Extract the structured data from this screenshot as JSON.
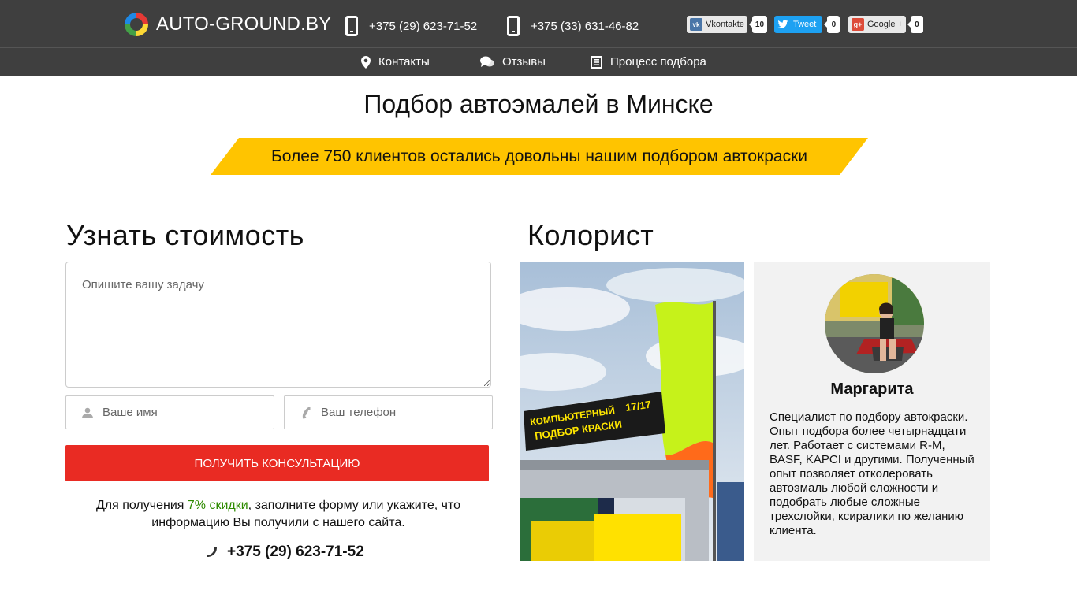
{
  "header": {
    "logo_text": "AUTO-GROUND.BY",
    "phone1": "+375 (29) 623-71-52",
    "phone2": "+375 (33) 631-46-82",
    "share": {
      "vk_label": "Vkontakte",
      "vk_count": "10",
      "tw_label": "Tweet",
      "tw_count": "0",
      "gp_label": "Google +",
      "gp_count": "0"
    }
  },
  "nav": {
    "items": [
      {
        "label": "Контакты",
        "icon": "map-pin-icon"
      },
      {
        "label": "Отзывы",
        "icon": "chat-bubbles-icon"
      },
      {
        "label": "Процесс подбора",
        "icon": "document-icon"
      }
    ]
  },
  "main": {
    "title": "Подбор автоэмалей в Минске",
    "banner": "Более 750 клиентов остались довольны нашим подбором автокраски",
    "banner_color": "#ffc400"
  },
  "form": {
    "title": "Узнать стоимость",
    "task_placeholder": "Опишите вашу задачу",
    "name_placeholder": "Ваше имя",
    "phone_placeholder": "Ваш телефон",
    "submit_label": "Получить консультацию",
    "note_before": "Для получения ",
    "note_highlight": "7% скидки",
    "note_after": ", заполните форму или укажите, что информацию Вы получили с нашего сайта.",
    "contact_phone": "+375 (29) 623-71-52",
    "accent_color": "#e92b23"
  },
  "colorist": {
    "title": "Колорист",
    "sign_line1": "КОМПЬЮТЕРНЫЙ",
    "sign_line2": "ПОДБОР КРАСКИ",
    "sign_number": "17/17",
    "name": "Маргарита",
    "description": "Специалист по подбору автокраски. Опыт подбора более четырнадцати лет. Работает с системами R-M, BASF, KAPCI и другими. Полученный опыт позволяет отколеровать автоэмаль любой сложности и подобрать любые сложные трехслойки, ксиралики по желанию клиента."
  }
}
